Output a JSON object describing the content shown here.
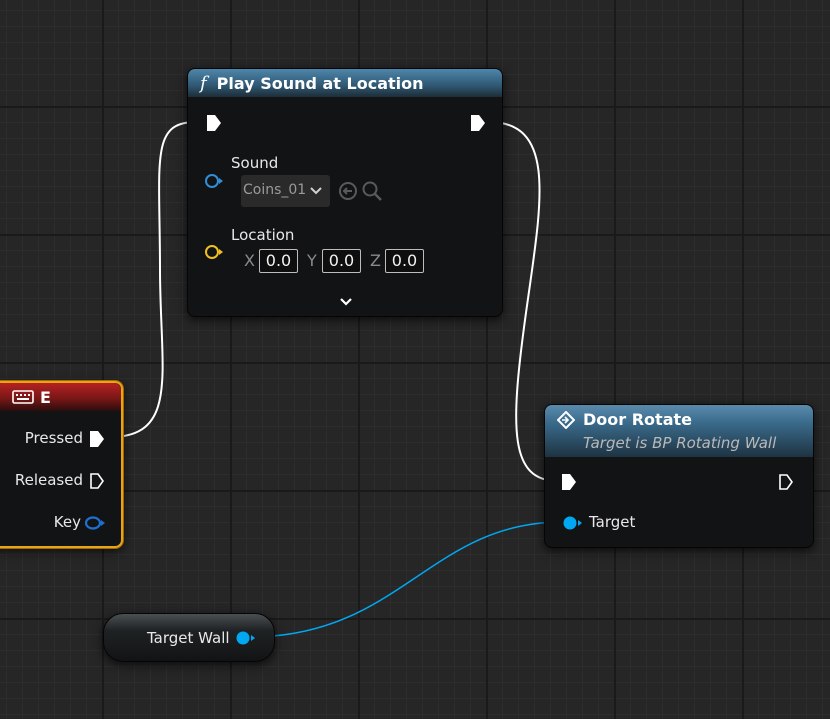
{
  "play_sound_node": {
    "title": "Play Sound at Location",
    "function_icon": "f",
    "sound_label": "Sound",
    "sound_value": "Coins_01",
    "location_label": "Location",
    "x_label": "X",
    "x_value": "0.0",
    "y_label": "Y",
    "y_value": "0.0",
    "z_label": "Z",
    "z_value": "0.0"
  },
  "key_event_node": {
    "title": "E",
    "pressed_label": "Pressed",
    "released_label": "Released",
    "key_label": "Key"
  },
  "door_rotate_node": {
    "title": "Door Rotate",
    "subtitle": "Target is BP Rotating Wall",
    "target_label": "Target"
  },
  "target_wall_node": {
    "label": "Target Wall"
  },
  "colors": {
    "exec_wire": "#ffffff",
    "object_wire": "#00a8f3",
    "sound_pin": "#2f8fd8",
    "vector_pin": "#f0c020",
    "key_header": "#8e1b1b",
    "function_header": "#3d6d8c",
    "selection": "#e8a316"
  }
}
